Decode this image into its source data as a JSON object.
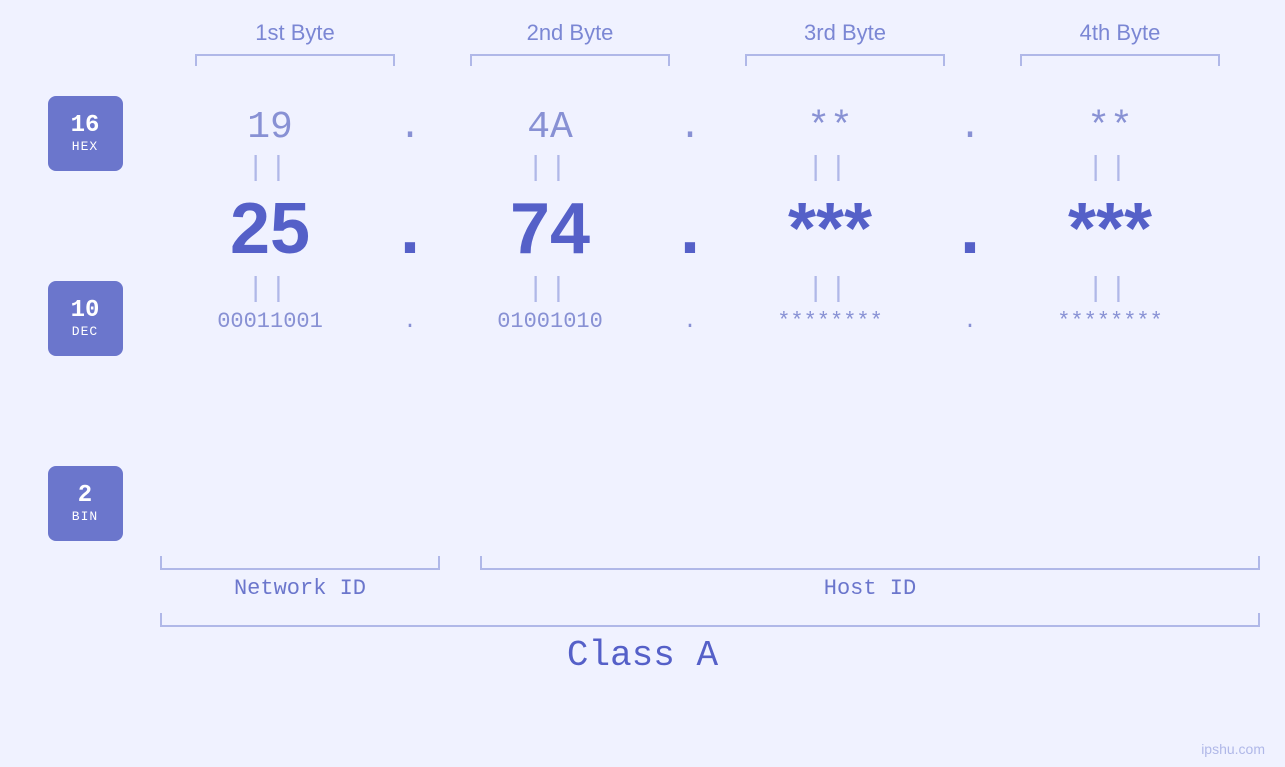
{
  "headers": {
    "col1": "1st Byte",
    "col2": "2nd Byte",
    "col3": "3rd Byte",
    "col4": "4th Byte"
  },
  "badges": {
    "hex": {
      "number": "16",
      "label": "HEX"
    },
    "dec": {
      "number": "10",
      "label": "DEC"
    },
    "bin": {
      "number": "2",
      "label": "BIN"
    }
  },
  "hex_row": {
    "b1": "19",
    "b2": "4A",
    "b3": "**",
    "b4": "**",
    "dots": [
      ".",
      ".",
      ".",
      "."
    ]
  },
  "dec_row": {
    "b1": "25",
    "b2": "74",
    "b3": "***",
    "b4": "***",
    "dots": [
      ".",
      ".",
      ".",
      "."
    ]
  },
  "bin_row": {
    "b1": "00011001",
    "b2": "01001010",
    "b3": "********",
    "b4": "********",
    "dots": [
      ".",
      ".",
      ".",
      "."
    ]
  },
  "labels": {
    "network_id": "Network ID",
    "host_id": "Host ID",
    "class": "Class A"
  },
  "watermark": "ipshu.com"
}
